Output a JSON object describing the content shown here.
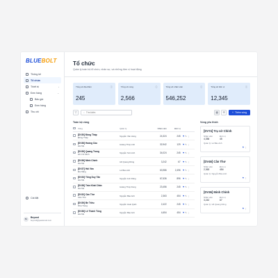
{
  "logo": {
    "part1": "BLUE",
    "part2": "BOLT"
  },
  "nav": {
    "items": [
      {
        "label": "Thống kê"
      },
      {
        "label": "Tổ chức",
        "active": true
      },
      {
        "label": "Thiết bị"
      },
      {
        "label": "Đơn hàng"
      },
      {
        "label": "Bảo giá"
      },
      {
        "label": "Đơn hàng"
      },
      {
        "label": "Thu chi"
      }
    ],
    "settings": "Cài đặt"
  },
  "user": {
    "initials": "Bo",
    "name": "Beyond",
    "email": "beyond@peelwood.com"
  },
  "page": {
    "title": "Tổ chức",
    "subtitle": "Quản lý toàn bộ tổ chức, nhân sự, và những đơn vị hoạt động"
  },
  "stats": [
    {
      "label": "Tổng số địa điểm",
      "value": "245"
    },
    {
      "label": "Tổng số vùng",
      "value": "2,566"
    },
    {
      "label": "Tổng số nhân viên",
      "value": "546,252"
    },
    {
      "label": "Tổng số đơn vị",
      "value": "12,345"
    }
  ],
  "toolbar": {
    "search_placeholder": "Tìm kiếm",
    "add_label": "Thêm vùng"
  },
  "table": {
    "title": "Toàn bộ vùng",
    "headers": {
      "name": "Vùng",
      "manager": "Quản lý",
      "staff": "Nhân viên",
      "units": "Đơn vị"
    },
    "rows": [
      {
        "code": "[DV30] Đồng Tháp",
        "place": "Đồng Tháp",
        "manager": "Nguyễn Văn Hùng",
        "staff": "24,324",
        "units": "245"
      },
      {
        "code": "[DV36] Hoàng Cầu",
        "place": "Hà Nội",
        "manager": "Hoàng Thúy Linh",
        "staff": "32,942",
        "units": "129"
      },
      {
        "code": "[DV39] Quang Trung",
        "place": "Hồ Chí Minh",
        "manager": "Nguyễn Sơn Anh",
        "staff": "34,024",
        "units": "245"
      },
      {
        "code": "[DV36] Minh Chính",
        "place": "Hà Nội",
        "manager": "Hồ Quang Dũng",
        "staff": "3,242",
        "units": "67"
      },
      {
        "code": "[DV37] Hải Vân",
        "place": "Đà Nẵng",
        "manager": "Lê Bảo Anh",
        "staff": "63,986",
        "units": "2,496"
      },
      {
        "code": "[DV33] Tổng Duy Tân",
        "place": "Hà Nội",
        "manager": "Nguyễn Anh Dũng",
        "staff": "67,636",
        "units": "896"
      },
      {
        "code": "[DV38] Trần Khát Chân",
        "place": "Hà Nội",
        "manager": "Hoàng Thúy Dung",
        "staff": "23,456",
        "units": "245"
      },
      {
        "code": "[DV32] Cần Thơ",
        "place": "Cần Thơ",
        "manager": "Nguyễn Bảo Anh",
        "staff": "2,363",
        "units": "454"
      },
      {
        "code": "[DV39] Bé Triều",
        "place": "Nha Trang",
        "manager": "Nguyễn Hoài Quốc",
        "staff": "2,422",
        "units": "245"
      },
      {
        "code": "[DV36] Lê Thánh Tông",
        "place": "Hà Nội",
        "manager": "Nguyễn Bảo Anh",
        "staff": "4,654",
        "units": "454"
      }
    ]
  },
  "side": {
    "title": "Vùng yêu thích",
    "cards": [
      {
        "title": "[DV74] Trụ sở Chính",
        "staff_label": "Nhân viên",
        "staff": "4,356",
        "units_label": "Đơn vị",
        "units": "45",
        "sub": "Quản lý: Lê Bảo Anh"
      },
      {
        "title": "[DV46] Cần Thơ",
        "staff_label": "Nhân viên",
        "staff": "2,363",
        "units_label": "Đơn vị",
        "units": "454",
        "sub": "Quản lý: Nguyễn Bảo Anh"
      },
      {
        "title": "[DV36] Minh Chính",
        "staff_label": "Nhân viên",
        "staff": "3,242",
        "units_label": "Đơn vị",
        "units": "67",
        "sub": "Quản lý: Hồ Quang Dũng"
      }
    ]
  },
  "colors": {
    "accent": "#1d4ed8",
    "stat_bg": "#e0ecfb",
    "logo_blue": "#1d4ed8",
    "logo_orange": "#f59e0b"
  }
}
